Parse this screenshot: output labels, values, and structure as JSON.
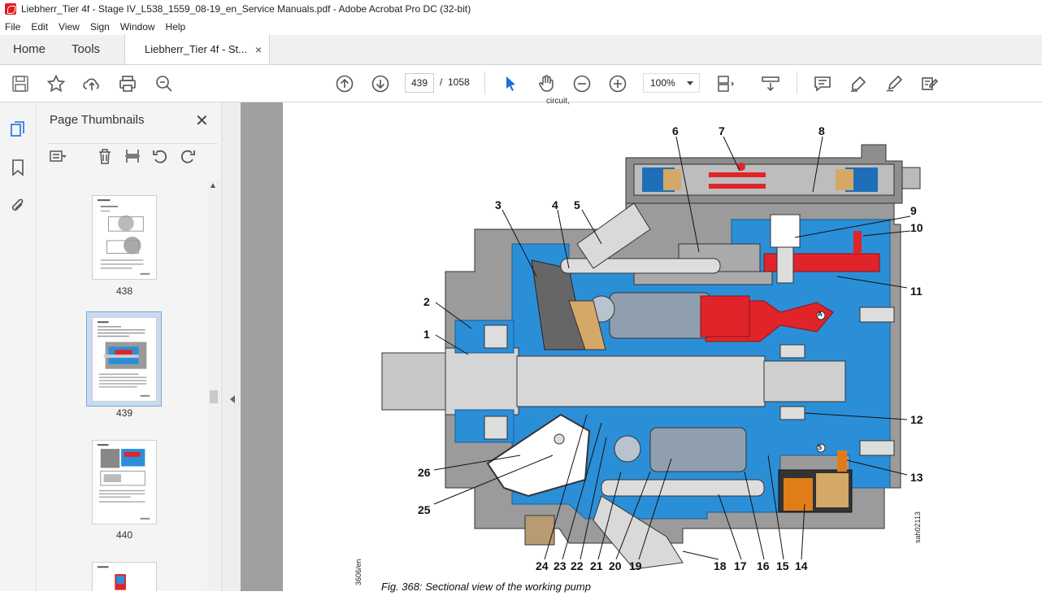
{
  "window": {
    "title": "Liebherr_Tier 4f - Stage IV_L538_1559_08-19_en_Service Manuals.pdf - Adobe Acrobat Pro DC (32-bit)"
  },
  "menu": {
    "items": [
      "File",
      "Edit",
      "View",
      "Sign",
      "Window",
      "Help"
    ]
  },
  "tabs": {
    "home": "Home",
    "tools": "Tools",
    "document": "Liebherr_Tier 4f - St...",
    "close": "×"
  },
  "toolbar": {
    "current_page": "439",
    "page_separator": "/",
    "total_pages": "1058",
    "zoom": "100%"
  },
  "thumbnails_panel": {
    "title": "Page Thumbnails",
    "close": "✕",
    "thumbs": [
      {
        "label": "438",
        "selected": false
      },
      {
        "label": "439",
        "selected": true
      },
      {
        "label": "440",
        "selected": false
      }
    ]
  },
  "document": {
    "top_fragment": "circuit,",
    "caption": "Fig. 368: Sectional view of the working pump",
    "figure_code": "sah02113",
    "page_code": "3606/en",
    "callouts": [
      "1",
      "2",
      "3",
      "4",
      "5",
      "6",
      "7",
      "8",
      "9",
      "10",
      "11",
      "12",
      "13",
      "14",
      "15",
      "16",
      "17",
      "18",
      "19",
      "20",
      "21",
      "22",
      "23",
      "24",
      "25",
      "26"
    ],
    "port_labels": [
      "A",
      "S"
    ]
  },
  "colors": {
    "accent_blue": "#1c71d8",
    "pump_blue": "#2b8fd8",
    "pump_red": "#e0242a",
    "pump_grey": "#8e8e8e",
    "brass": "#d4a866"
  },
  "icons": {
    "rail": [
      "pages-icon",
      "bookmark-icon",
      "attachment-icon"
    ],
    "toolbar": [
      "save-icon",
      "star-icon",
      "upload-icon",
      "print-icon",
      "zoom-search-icon",
      "page-up-icon",
      "page-down-icon",
      "select-arrow-icon",
      "hand-icon",
      "zoom-out-icon",
      "zoom-in-icon",
      "page-fit-icon",
      "scroll-mode-icon",
      "comment-icon",
      "highlight-icon",
      "sign-icon",
      "edit-icon"
    ]
  }
}
